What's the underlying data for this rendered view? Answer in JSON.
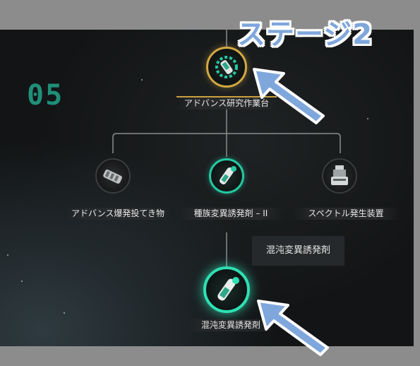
{
  "stage_number": "05",
  "overlay_title": "ステージ2",
  "tooltip": "混沌変異誘発剤",
  "nodes": {
    "top": {
      "label": "アドバンス研究作業台",
      "icon": "mutagen-icon"
    },
    "left": {
      "label": "アドバンス爆発投てき物",
      "icon": "grenade-icon"
    },
    "center": {
      "label": "種族変異誘発剤 – II",
      "icon": "mutagen-icon"
    },
    "right": {
      "label": "スペクトル発生装置",
      "icon": "spectrum-device-icon"
    },
    "bottom": {
      "label": "混沌変異誘発剤",
      "icon": "mutagen-icon"
    }
  },
  "colors": {
    "accent_green": "#2fe0b4",
    "gold": "#d3a844",
    "stage_number": "#1f8f78",
    "overlay_blue": "#7fa7dc"
  }
}
